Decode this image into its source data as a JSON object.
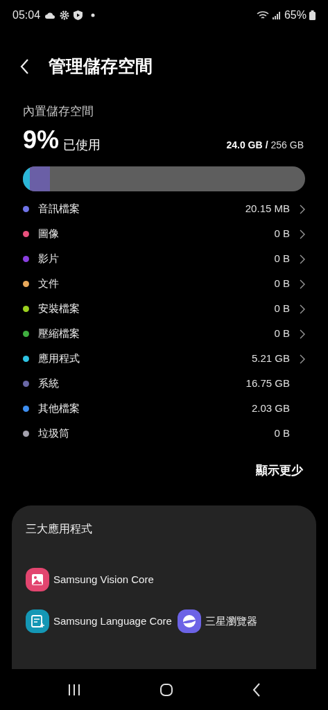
{
  "status_bar": {
    "time": "05:04",
    "battery": "65%"
  },
  "title": "管理儲存空間",
  "storage": {
    "label": "內置儲存空間",
    "percent": "9%",
    "used_label": "已使用",
    "used": "24.0 GB",
    "separator": "/",
    "total": "256 GB",
    "segments": [
      {
        "color": "#2bb6d8",
        "level": 0.025
      },
      {
        "color": "#6a5fa6",
        "level": 0.07
      }
    ]
  },
  "categories": [
    {
      "name": "音訊檔案",
      "size": "20.15 MB",
      "color": "#6f73e8",
      "chevron": true
    },
    {
      "name": "圖像",
      "size": "0 B",
      "color": "#e8507c",
      "chevron": true
    },
    {
      "name": "影片",
      "size": "0 B",
      "color": "#8a3fe0",
      "chevron": true
    },
    {
      "name": "文件",
      "size": "0 B",
      "color": "#e9a85a",
      "chevron": true
    },
    {
      "name": "安裝檔案",
      "size": "0 B",
      "color": "#9bd11f",
      "chevron": true
    },
    {
      "name": "壓縮檔案",
      "size": "0 B",
      "color": "#3fae3f",
      "chevron": true
    },
    {
      "name": "應用程式",
      "size": "5.21 GB",
      "color": "#2ec3e3",
      "chevron": true
    },
    {
      "name": "系統",
      "size": "16.75 GB",
      "color": "#6a68a6",
      "chevron": false
    },
    {
      "name": "其他檔案",
      "size": "2.03 GB",
      "color": "#3d8ef0",
      "chevron": false
    },
    {
      "name": "垃圾筒",
      "size": "0 B",
      "color": "#a3a1ad",
      "chevron": false
    }
  ],
  "show_less": "顯示更少",
  "top_apps": {
    "title": "三大應用程式",
    "apps": [
      {
        "name": "Samsung Vision Core",
        "kind": "gallery"
      },
      {
        "name": "Samsung Language Core",
        "kind": "text"
      },
      {
        "name": "三星瀏覽器",
        "kind": "browser"
      }
    ]
  }
}
